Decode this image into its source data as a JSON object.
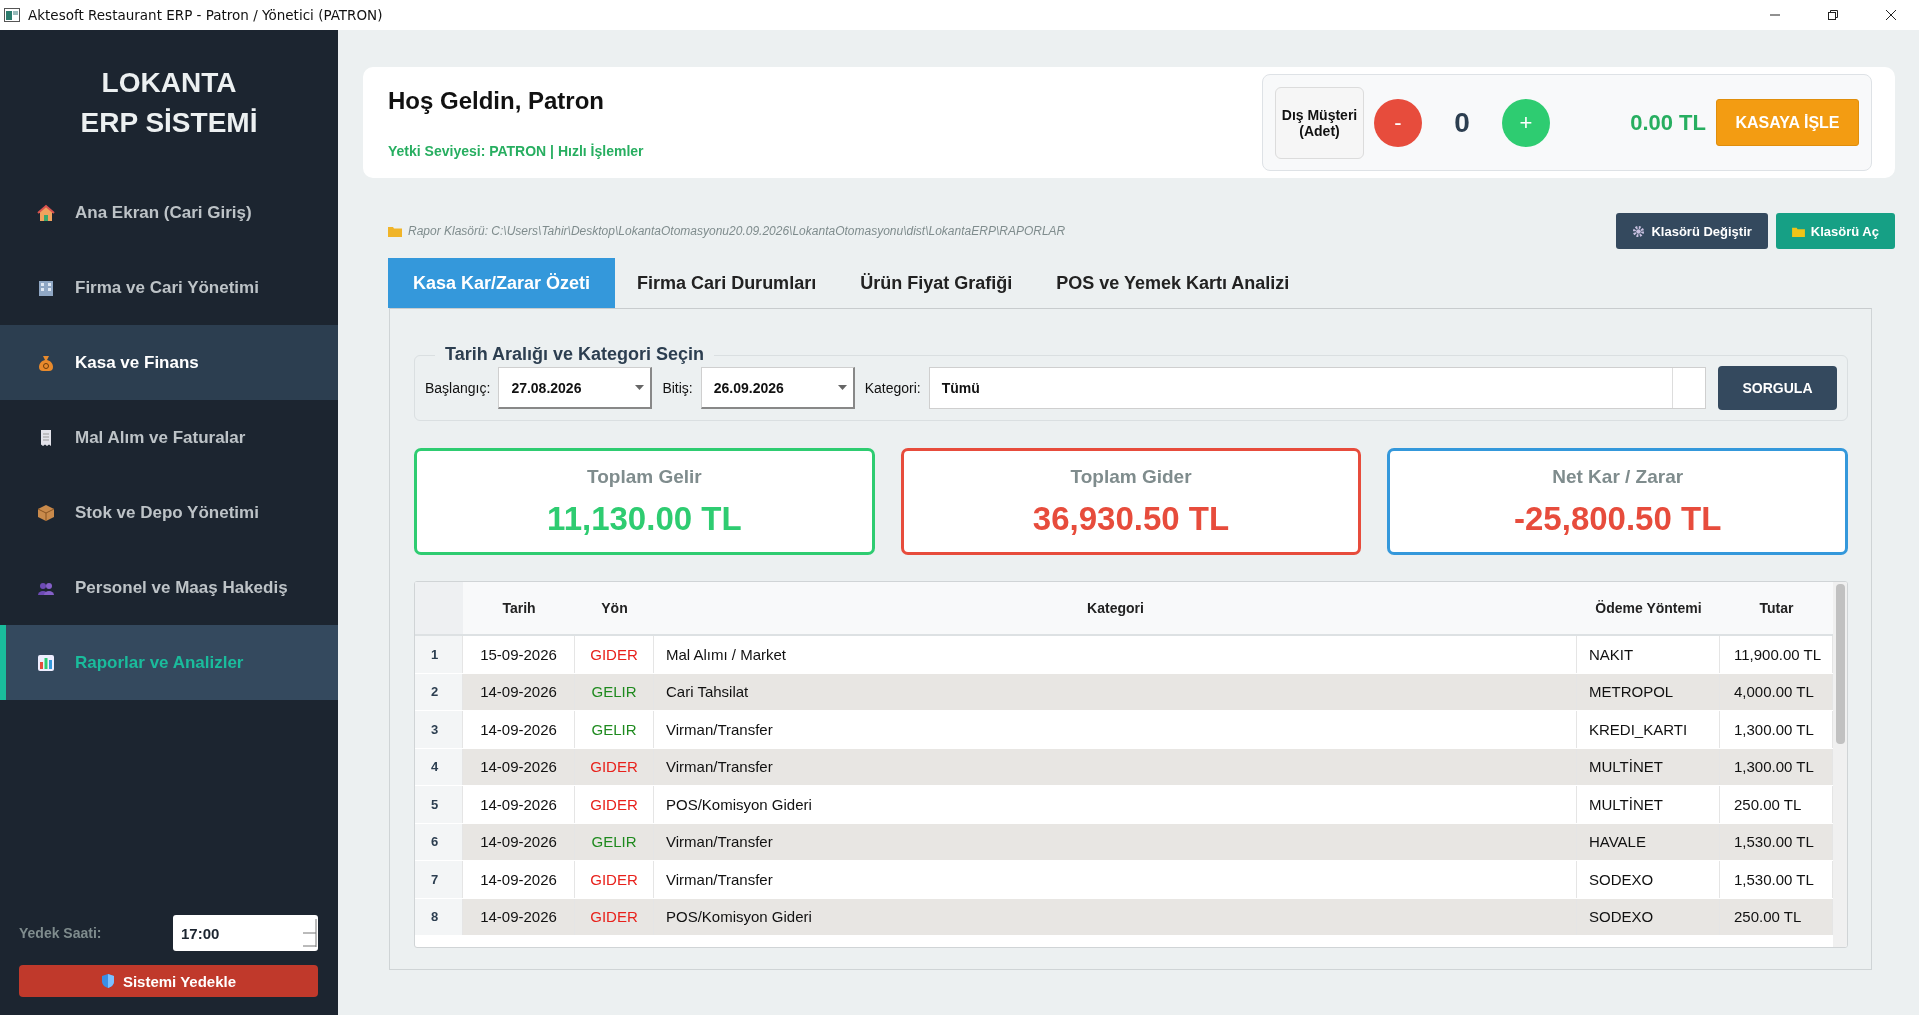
{
  "window": {
    "title": "Aktesoft Restaurant ERP - Patron / Yönetici (PATRON)"
  },
  "sidebar": {
    "title_lines": [
      "LOKANTA",
      "ERP SİSTEMİ"
    ],
    "items": [
      {
        "label": "Ana Ekran (Cari Giriş)",
        "selected": false,
        "hovered": false
      },
      {
        "label": "Firma ve Cari Yönetimi",
        "selected": false,
        "hovered": false
      },
      {
        "label": "Kasa ve Finans",
        "selected": false,
        "hovered": true
      },
      {
        "label": "Mal Alım ve Faturalar",
        "selected": false,
        "hovered": false
      },
      {
        "label": "Stok ve Depo Yönetimi",
        "selected": false,
        "hovered": false
      },
      {
        "label": "Personel ve Maaş Hakediş",
        "selected": false,
        "hovered": false
      },
      {
        "label": "Raporlar ve Analizler",
        "selected": true,
        "hovered": false
      }
    ],
    "backup_time": {
      "label": "Yedek Saati:",
      "value": "17:00"
    },
    "backup_button": "Sistemi Yedekle"
  },
  "header": {
    "greeting": "Hoş Geldin, Patron",
    "subtitle": "Yetki Seviyesi: PATRON | Hızlı İşlemler",
    "walk_in": {
      "label": "Dış Müşteri (Adet)",
      "minus": "-",
      "count": "0",
      "plus": "+",
      "total": "0.00 TL",
      "button": "KASAYA İŞLE"
    }
  },
  "report_folder": {
    "text": "Rapor Klasörü: C:\\Users\\Tahir\\Desktop\\LokantaOtomasyonu20.09.2026\\LokantaOtomasyonu\\dist\\LokantaERP\\RAPORLAR",
    "change_button": "Klasörü Değiştir",
    "open_button": "Klasörü Aç"
  },
  "tabs": [
    {
      "label": "Kasa Kar/Zarar Özeti",
      "selected": true
    },
    {
      "label": "Firma Cari Durumları",
      "selected": false
    },
    {
      "label": "Ürün Fiyat Grafiği",
      "selected": false
    },
    {
      "label": "POS ve Yemek Kartı Analizi",
      "selected": false
    }
  ],
  "filters": {
    "title": "Tarih Aralığı ve Kategori Seçin",
    "start_label": "Başlangıç:",
    "start": "27.08.2026",
    "end_label": "Bitiş:",
    "end": "26.09.2026",
    "category_label": "Kategori:",
    "category": "Tümü",
    "button": "SORGULA"
  },
  "summary": [
    {
      "label": "Toplam Gelir",
      "value": "11,130.00 TL",
      "color": "#2ecc71",
      "loss": false
    },
    {
      "label": "Toplam Gider",
      "value": "36,930.50 TL",
      "color": "#e74c3c",
      "loss": true
    },
    {
      "label": "Net Kar / Zarar",
      "value": "-25,800.50 TL",
      "color": "#3498db",
      "loss": true
    }
  ],
  "table": {
    "columns": [
      "Tarih",
      "Yön",
      "Kategori",
      "Ödeme Yöntemi",
      "Tutar"
    ],
    "rows": [
      {
        "index": "1",
        "date": "15-09-2026",
        "direction": "GIDER",
        "kind": "expense",
        "category": "Mal Alımı / Market",
        "payment": "NAKIT",
        "amount": "11,900.00 TL"
      },
      {
        "index": "2",
        "date": "14-09-2026",
        "direction": "GELIR",
        "kind": "income",
        "category": "Cari Tahsilat",
        "payment": "METROPOL",
        "amount": "4,000.00 TL"
      },
      {
        "index": "3",
        "date": "14-09-2026",
        "direction": "GELIR",
        "kind": "income",
        "category": "Virman/Transfer",
        "payment": "KREDI_KARTI",
        "amount": "1,300.00 TL"
      },
      {
        "index": "4",
        "date": "14-09-2026",
        "direction": "GIDER",
        "kind": "expense",
        "category": "Virman/Transfer",
        "payment": "MULTİNET",
        "amount": "1,300.00 TL"
      },
      {
        "index": "5",
        "date": "14-09-2026",
        "direction": "GIDER",
        "kind": "expense",
        "category": "POS/Komisyon Gideri",
        "payment": "MULTİNET",
        "amount": "250.00 TL"
      },
      {
        "index": "6",
        "date": "14-09-2026",
        "direction": "GELIR",
        "kind": "income",
        "category": "Virman/Transfer",
        "payment": "HAVALE",
        "amount": "1,530.00 TL"
      },
      {
        "index": "7",
        "date": "14-09-2026",
        "direction": "GIDER",
        "kind": "expense",
        "category": "Virman/Transfer",
        "payment": "SODEXO",
        "amount": "1,530.00 TL"
      },
      {
        "index": "8",
        "date": "14-09-2026",
        "direction": "GIDER",
        "kind": "expense",
        "category": "POS/Komisyon Gideri",
        "payment": "SODEXO",
        "amount": "250.00 TL"
      }
    ]
  }
}
